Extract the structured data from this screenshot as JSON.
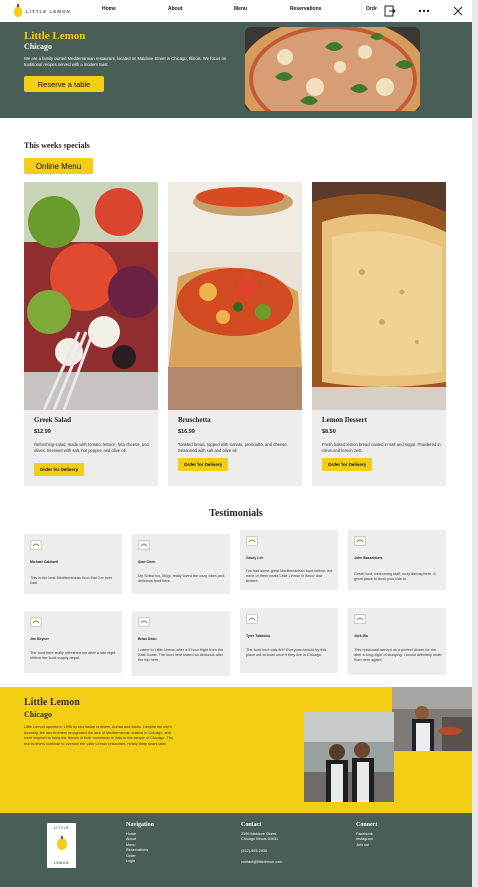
{
  "nav": {
    "logo_text": "LITTLE LEMON",
    "links": [
      "Home",
      "About",
      "Menu",
      "Reservations",
      "Order"
    ]
  },
  "browser": {
    "icons": [
      "exit-icon",
      "more-icon",
      "close-icon"
    ]
  },
  "hero": {
    "title": "Little Lemon",
    "subtitle": "Chicago",
    "description": "We are a family owned Mediterranean restaurant, located on Maldove Street in Chicago, Illinois. We focus on traditional recipes served with a modern twist.",
    "button": "Reserve a table"
  },
  "specials": {
    "title": "This weeks specials",
    "online_button": "Online Menu",
    "items": [
      {
        "name": "Greek Salad",
        "price": "$12.99",
        "description": "Refreshing salad, made with tomato, lettuce, feta cheese, and olives. Dressed with salt, hot pepper, and olive oil.",
        "button": "Order for Delivery"
      },
      {
        "name": "Bruschetta",
        "price": "$16.99",
        "description": "Toasted bread, topped with tomato, prosciutto, and cheese. Seasoned with salt and olive oil.",
        "button": "Order for Delivery"
      },
      {
        "name": "Lemon Dessert",
        "price": "$8.50",
        "description": "Fresh baked lemon bread coated in salt and sugar. Powdered in citrus and lemon zest.",
        "button": "Order for Delivery"
      }
    ]
  },
  "testimonials": {
    "title": "Testimonials",
    "items": [
      {
        "name": "Michael Caldwell",
        "text": "This is the best Mediterranean food that I've ever had!"
      },
      {
        "name": "Alan Chen",
        "text": "My Shiba Inu, Mugi, really loved the cozy vibes and delicious food here."
      },
      {
        "name": "Casey Lee",
        "text": "I've had some great Mediterranean food before, but none of them beats Little Lemon in flavor and texture."
      },
      {
        "name": "John Bazzelduns",
        "text": "Great food, welcoming staff, cozy atmosphere. A great place to treat your kids to."
      },
      {
        "name": "Jim Beyner",
        "text": "The food here really refreshed me after a late night shift at the local supply depot."
      },
      {
        "name": "Brian Dean",
        "text": "I came to Little Lemon after a 5 hour flight from the East Coast. The food here tasted so delicious after the trip here."
      },
      {
        "name": "Tyler Tobasiso",
        "text": "The food here was fire! Everyone should try this place out at least once if they live in Chicago."
      },
      {
        "name": "Jack Wu",
        "text": "This restaurant served as a perfect dinner for me after a long night of studying. I would definitely order from here again!"
      }
    ]
  },
  "about": {
    "title": "Little Lemon",
    "subtitle": "Chicago",
    "text": "Little Lemon opened in 1995 by two Italian brothers, Adrian and Mario. Despite the city's diversity, the two brothers recognized the lack of Mediterranean cuisine in Chicago, and were inspired to bring the flavors of their hometown in Italy to the people of Chicago. The two brothers continue to oversee the Little Lemon restaurant, nearly thirty years later."
  },
  "footer": {
    "logo_top": "LITTLE",
    "logo_bottom": "LEMON",
    "navigation": {
      "title": "Navigation",
      "items": [
        "Home",
        "About",
        "Menu",
        "Reservations",
        "Order",
        "Login"
      ]
    },
    "contact": {
      "title": "Contact",
      "address_1": "2395 Maldove Street,",
      "address_2": "Chicago Illinois 60631",
      "phone": "(312)-593-2930",
      "email": "contact@littlelemon.com"
    },
    "connect": {
      "title": "Connect",
      "items": [
        "Facebook",
        "Instagram",
        "Join us!"
      ]
    }
  },
  "colors": {
    "green": "#495e57",
    "yellow": "#f4ce14"
  }
}
